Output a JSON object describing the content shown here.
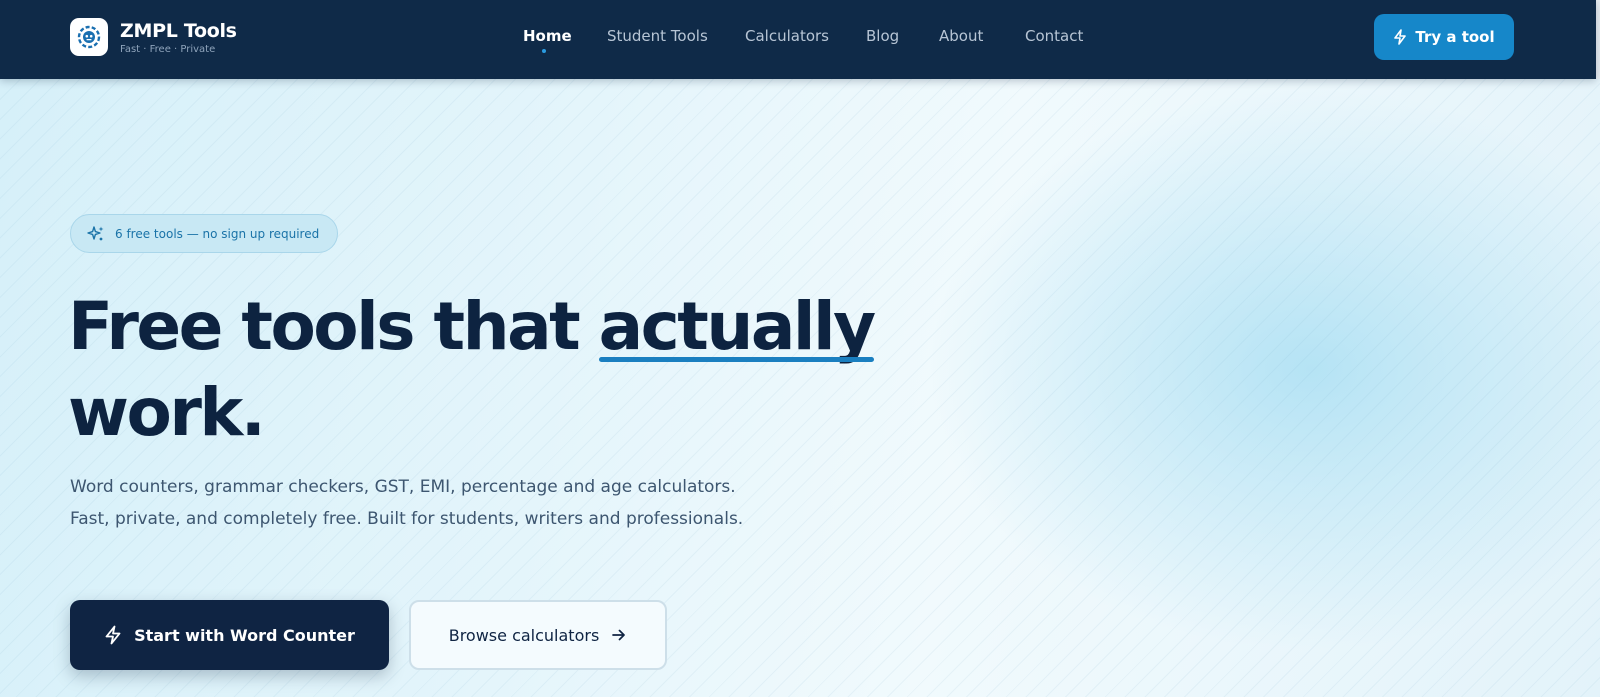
{
  "header": {
    "brand_name": "ZMPL Tools",
    "brand_tagline": "Fast · Free · Private",
    "logo_icon": "gear-bot-logo",
    "nav": [
      {
        "label": "Home",
        "active": true
      },
      {
        "label": "Student Tools",
        "active": false
      },
      {
        "label": "Calculators",
        "active": false
      },
      {
        "label": "Blog",
        "active": false
      },
      {
        "label": "About",
        "active": false
      },
      {
        "label": "Contact",
        "active": false
      }
    ],
    "cta_label": "Try a tool",
    "cta_icon": "lightning-icon"
  },
  "hero": {
    "badge_icon": "sparkles-icon",
    "badge_text": "6 free tools — no sign up required",
    "headline_part1": "Free tools that ",
    "headline_emphasis": "actually",
    "headline_part2": "work.",
    "subtext_line1": "Word counters, grammar checkers, GST, EMI, percentage and age calculators.",
    "subtext_line2": "Fast, private, and completely free. Built for students, writers and professionals.",
    "primary_button": "Start with Word Counter",
    "primary_icon": "lightning-icon",
    "secondary_button": "Browse calculators",
    "secondary_icon": "arrow-right-icon"
  },
  "colors": {
    "header_bg": "#0f2a48",
    "accent": "#1687c9",
    "headline": "#0d2340",
    "hero_bg": "#e6f6fb"
  }
}
